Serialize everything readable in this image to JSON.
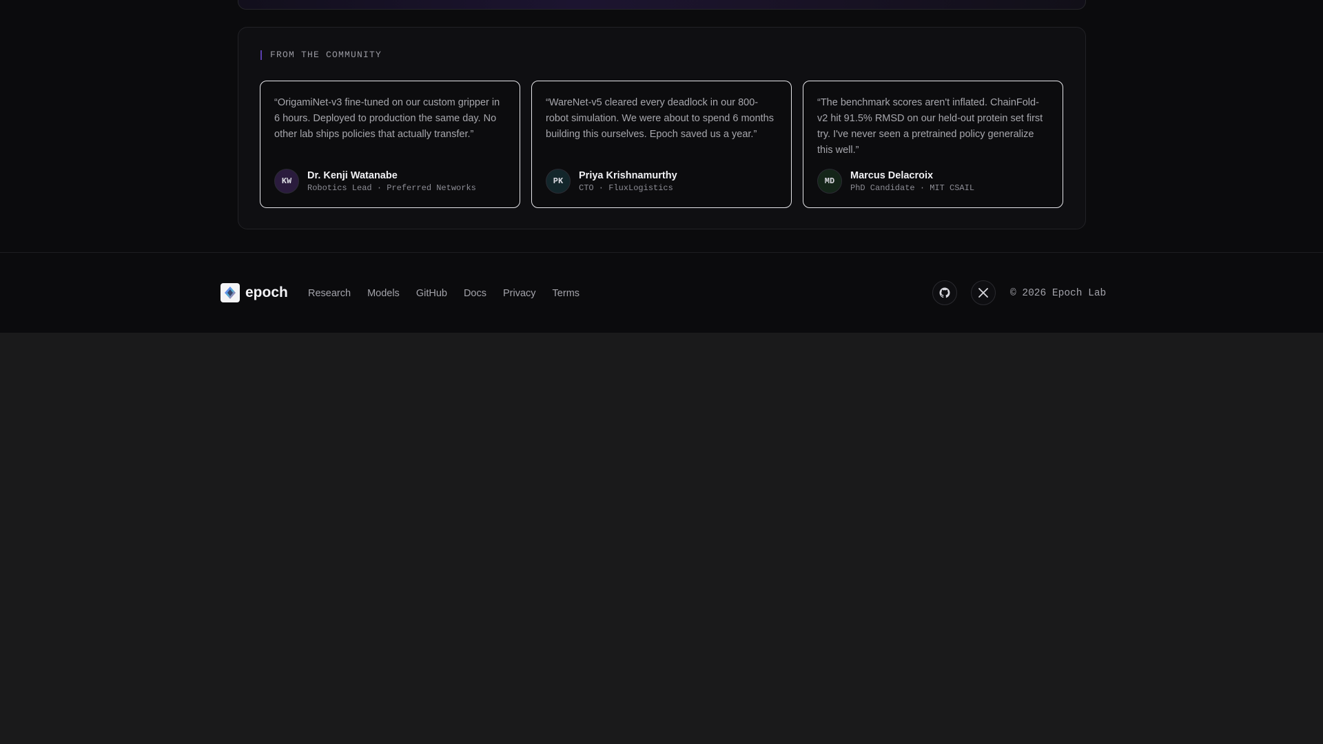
{
  "community": {
    "section_label": "FROM THE COMMUNITY",
    "testimonials": [
      {
        "quote": "“OrigamiNet-v3 fine-tuned on our custom gripper in 6 hours. Deployed to production the same day. No other lab ships policies that actually transfer.”",
        "initials": "KW",
        "name": "Dr. Kenji Watanabe",
        "role": "Robotics Lead · Preferred Networks",
        "avatar_color": "#2a1b3d"
      },
      {
        "quote": "“WareNet-v5 cleared every deadlock in our 800-robot simulation. We were about to spend 6 months building this ourselves. Epoch saved us a year.”",
        "initials": "PK",
        "name": "Priya Krishnamurthy",
        "role": "CTO · FluxLogistics",
        "avatar_color": "#13262b"
      },
      {
        "quote": "“The benchmark scores aren't inflated. ChainFold-v2 hit 91.5% RMSD on our held-out protein set first try. I've never seen a pretrained policy generalize this well.”",
        "initials": "MD",
        "name": "Marcus Delacroix",
        "role": "PhD Candidate · MIT CSAIL",
        "avatar_color": "#142519"
      }
    ]
  },
  "footer": {
    "brand_name": "epoch",
    "nav": [
      "Research",
      "Models",
      "GitHub",
      "Docs",
      "Privacy",
      "Terms"
    ],
    "social_icons": [
      "github-icon",
      "x-icon"
    ],
    "copyright": "© 2026 Epoch Lab"
  },
  "colors": {
    "accent": "#5b3fb0",
    "page_dark": "#0b0b0d",
    "page_lower": "#1a1a1b"
  }
}
